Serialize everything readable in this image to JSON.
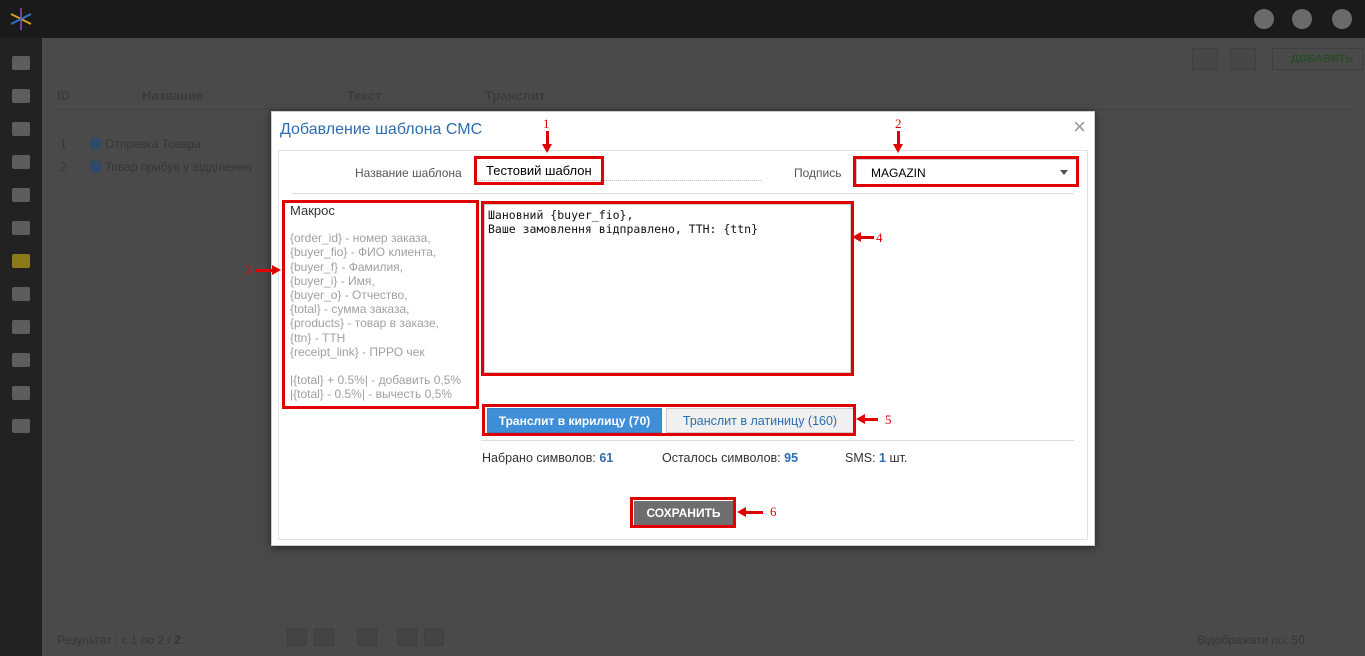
{
  "background": {
    "headers": [
      "ID",
      "Название",
      "Текст",
      "Транслит"
    ],
    "rows": [
      {
        "id": "1",
        "name": "Отправка Товара"
      },
      {
        "id": "2",
        "name": "Товар прибув у відділення"
      }
    ],
    "add_button": "ДОБАВИТЬ",
    "result_text": "Результат : с 1 по 2 /",
    "result_total": "2",
    "per_page_label": "Відображати по:",
    "per_page_value": "50"
  },
  "modal": {
    "title": "Добавление шаблона СМС",
    "close_glyph": "×",
    "name_label": "Название шаблона",
    "name_value": "Тестовий шаблон",
    "signature_label": "Подпись",
    "signature_value": "MAGAZIN",
    "macros": {
      "title": "Макрос",
      "items": [
        "{order_id} - номер заказа,",
        "{buyer_fio} - ФИО клиента,",
        "{buyer_f} - Фамилия,",
        "{buyer_i} - Имя,",
        "{buyer_o} - Отчество,",
        "{total} - сумма заказа,",
        "{products} - товар в заказе,",
        "{ttn} - ТТН",
        "{receipt_link} - ПРРО чек"
      ],
      "extra": [
        "|{total} + 0.5%| - добавить 0,5%",
        "|{total} - 0.5%| - вычесть 0,5%"
      ]
    },
    "message_text": "Шановний {buyer_fio},\nВаше замовлення відправлено, ТТН: {ttn}",
    "translit_cyr_button": "Транслит в кирилицу (70)",
    "translit_lat_button": "Транслит в латиницу (160)",
    "stats": {
      "typed_label": "Набрано символов:",
      "typed_value": "61",
      "left_label": "Осталось символов:",
      "left_value": "95",
      "sms_label": "SMS:",
      "sms_value": "1",
      "sms_unit": "шт."
    },
    "save_button": "СОХРАНИТЬ"
  },
  "annotations": [
    "1",
    "2",
    "3",
    "4",
    "5",
    "6"
  ],
  "colors": {
    "accent": "#2d6db0",
    "annotation": "#e00000",
    "primary_button": "#3f8fd8",
    "save_button": "#6e6e6e"
  }
}
